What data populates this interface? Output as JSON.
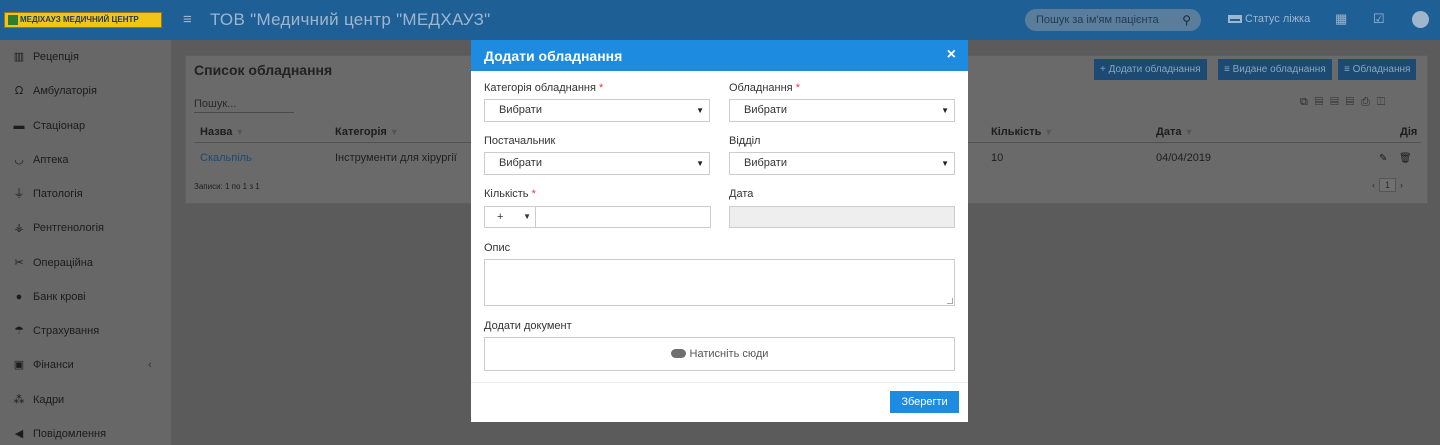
{
  "header": {
    "brand": "МЕДІХАУЗ МЕДИЧНИЙ ЦЕНТР",
    "title": "ТОВ \"Медичний центр \"МЕДХАУЗ\"",
    "search_placeholder": "Пошук за ім'ям пацієнта",
    "bed_status": "Статус ліжка"
  },
  "sidebar": {
    "items": [
      {
        "label": "Рецепція",
        "icon": "building-icon"
      },
      {
        "label": "Амбулаторія",
        "icon": "stethoscope-icon"
      },
      {
        "label": "Стаціонар",
        "icon": "bed-icon"
      },
      {
        "label": "Аптека",
        "icon": "mortar-icon"
      },
      {
        "label": "Патологія",
        "icon": "microscope-icon"
      },
      {
        "label": "Рентгенологія",
        "icon": "xray-icon"
      },
      {
        "label": "Операційна",
        "icon": "scissors-icon"
      },
      {
        "label": "Банк крові",
        "icon": "blood-drop-icon"
      },
      {
        "label": "Страхування",
        "icon": "umbrella-icon"
      },
      {
        "label": "Фінанси",
        "icon": "money-icon"
      },
      {
        "label": "Кадри",
        "icon": "sitemap-icon"
      },
      {
        "label": "Повідомлення",
        "icon": "bullhorn-icon"
      }
    ]
  },
  "panel": {
    "title": "Список обладнання",
    "buttons": {
      "add": "+ Додати обладнання",
      "issued": "≡ Видане обладнання",
      "equipment": "≡ Обладнання"
    },
    "search_placeholder": "Пошук...",
    "columns": {
      "name": "Назва",
      "category": "Категорія",
      "quantity": "Кількість",
      "date": "Дата",
      "actions": "Дія"
    },
    "rows": [
      {
        "name": "Скальпіль",
        "category": "Інструменти для хірургії",
        "quantity": "10",
        "date": "04/04/2019"
      }
    ],
    "records_info": "Записи: 1 по 1 з 1",
    "pager": {
      "prev": "‹",
      "page": "1",
      "next": "›"
    }
  },
  "modal": {
    "title": "Додати обладнання",
    "close": "×",
    "fields": {
      "category_label": "Категорія обладнання",
      "category_value": "Вибрати",
      "equipment_label": "Обладнання",
      "equipment_value": "Вибрати",
      "supplier_label": "Постачальник",
      "supplier_value": "Вибрати",
      "department_label": "Відділ",
      "department_value": "Вибрати",
      "quantity_label": "Кількість",
      "quantity_sign": "+",
      "quantity_value": "",
      "date_label": "Дата",
      "date_value": "",
      "description_label": "Опис",
      "description_value": "",
      "document_label": "Додати документ",
      "upload_text": "Натисніть сюди"
    },
    "required_mark": "*",
    "save": "Зберегти"
  },
  "colors": {
    "topbar": "#1e5f96",
    "modal_header": "#1d8be0",
    "primary_button": "#1d8be0",
    "required": "#e53935"
  }
}
